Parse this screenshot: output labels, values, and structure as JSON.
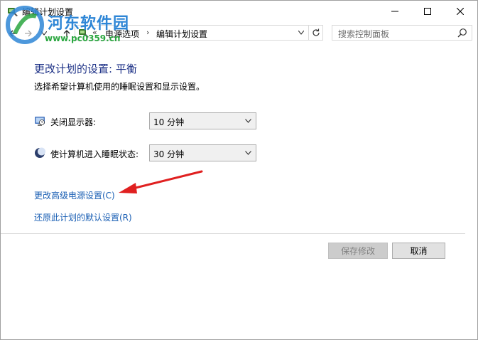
{
  "window": {
    "title": "编辑计划设置"
  },
  "watermark": {
    "site_name": "河东软件园",
    "site_url": "www.pc0359.cn"
  },
  "nav": {
    "breadcrumb_overflow": "«",
    "breadcrumb": [
      "电源选项",
      "编辑计划设置"
    ],
    "search_placeholder": "搜索控制面板"
  },
  "content": {
    "heading": "更改计划的设置: 平衡",
    "description": "选择希望计算机使用的睡眠设置和显示设置。",
    "settings": [
      {
        "icon": "monitor-clock-icon",
        "label": "关闭显示器:",
        "value": "10 分钟"
      },
      {
        "icon": "moon-sleep-icon",
        "label": "使计算机进入睡眠状态:",
        "value": "30 分钟"
      }
    ],
    "links": {
      "advanced": "更改高级电源设置(C)",
      "restore": "还原此计划的默认设置(R)"
    }
  },
  "buttons": {
    "save": "保存修改",
    "cancel": "取消"
  },
  "colors": {
    "heading": "#1e3287",
    "link": "#1a5fb4",
    "annotation_arrow": "#e02020"
  }
}
